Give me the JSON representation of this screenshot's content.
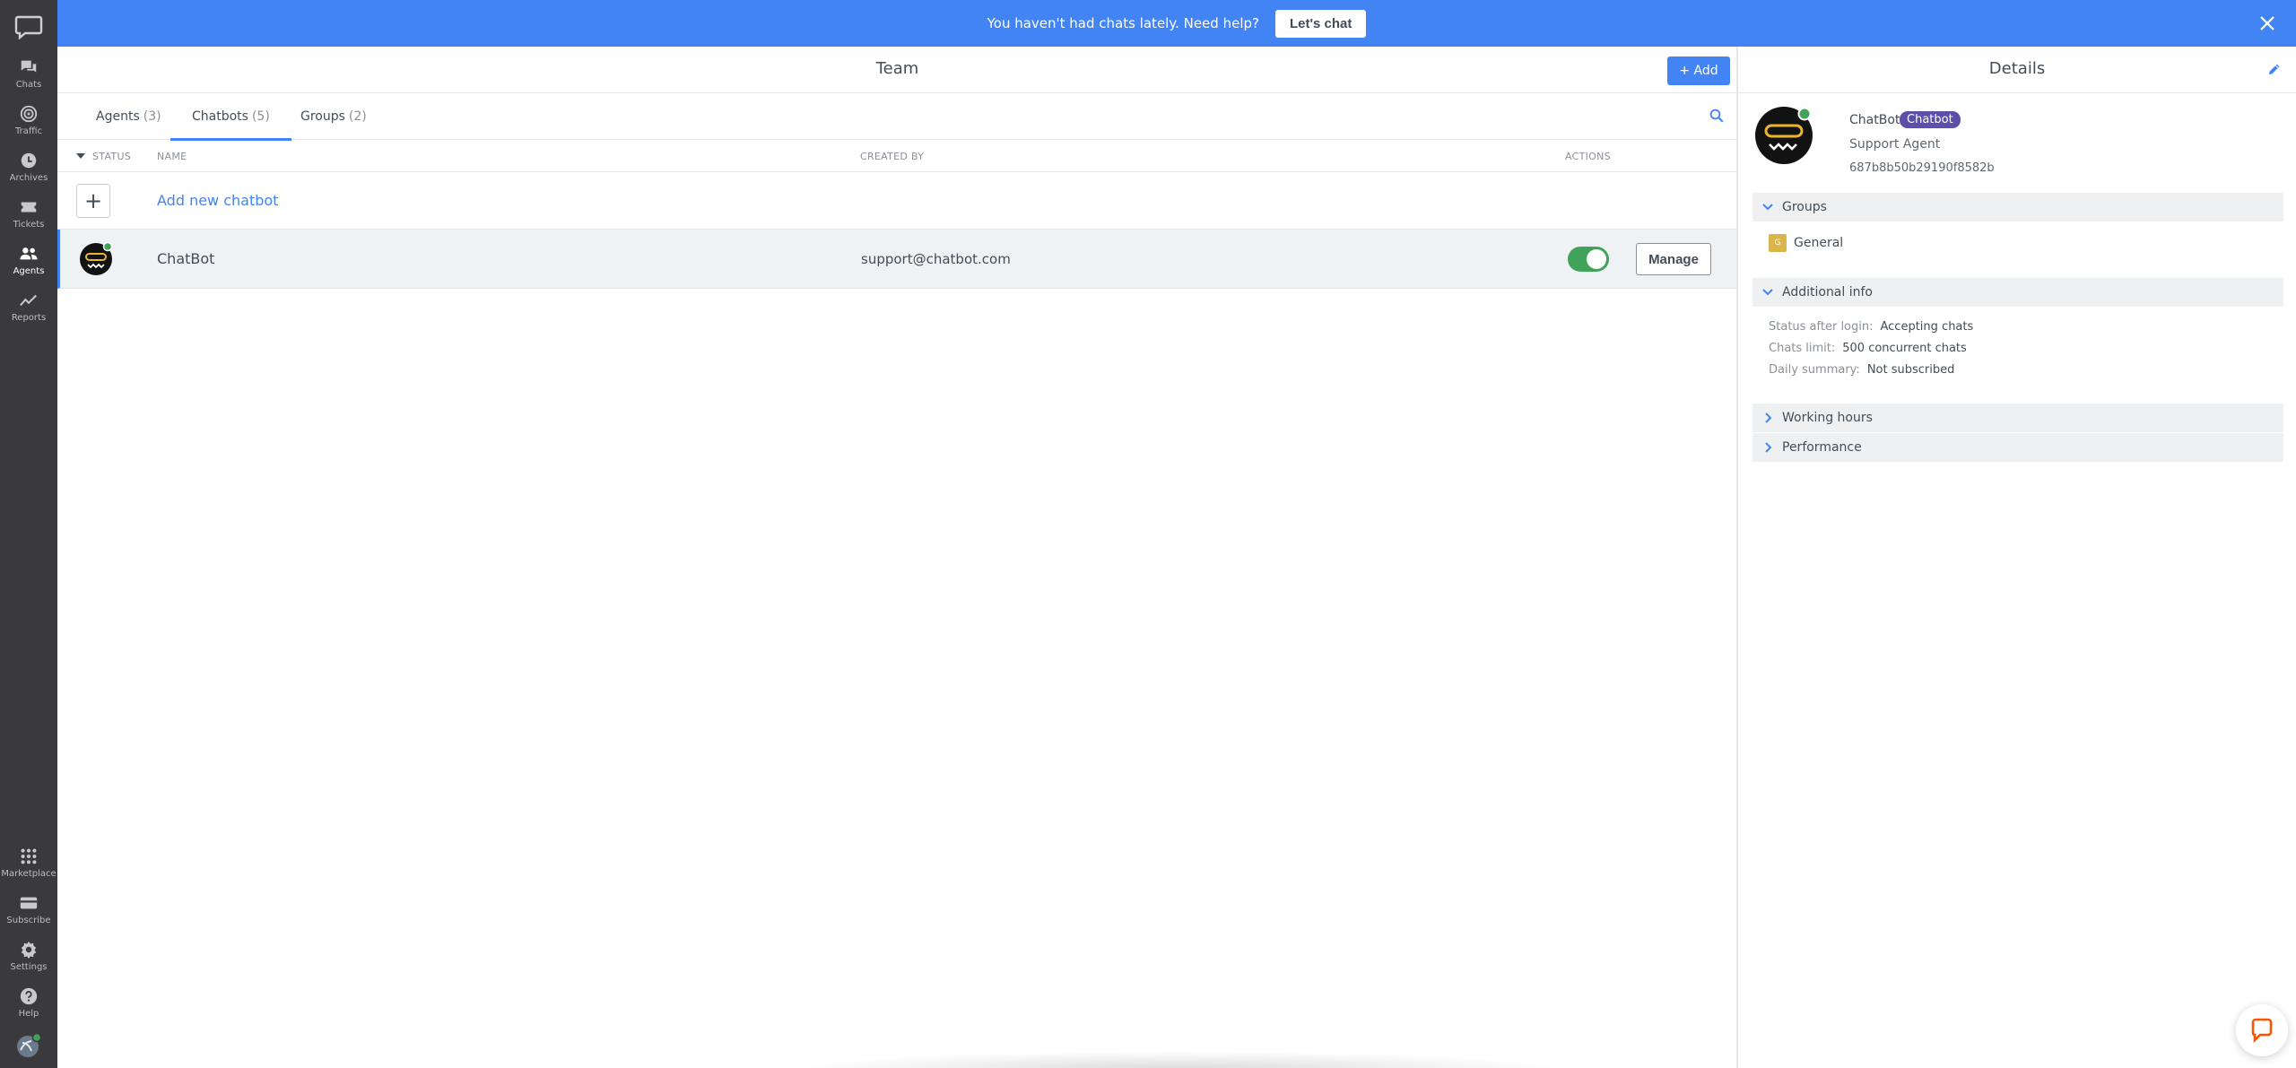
{
  "nav": {
    "items": [
      {
        "label": "Chats",
        "icon": "chat-bubbles-icon"
      },
      {
        "label": "Traffic",
        "icon": "traffic-icon"
      },
      {
        "label": "Archives",
        "icon": "clock-icon"
      },
      {
        "label": "Tickets",
        "icon": "ticket-icon"
      },
      {
        "label": "Agents",
        "icon": "people-icon",
        "active": true
      },
      {
        "label": "Reports",
        "icon": "chart-line-icon"
      }
    ],
    "bottom_items": [
      {
        "label": "Marketplace",
        "icon": "grid-icon"
      },
      {
        "label": "Subscribe",
        "icon": "credit-card-icon"
      },
      {
        "label": "Settings",
        "icon": "gear-icon"
      },
      {
        "label": "Help",
        "icon": "question-icon"
      }
    ]
  },
  "banner": {
    "message": "You haven't had chats lately. Need help?",
    "button": "Let's chat",
    "bg_color": "#4384f5"
  },
  "main": {
    "title": "Team",
    "add_button": "+ Add",
    "tabs": [
      {
        "label": "Agents",
        "count": "(3)"
      },
      {
        "label": "Chatbots",
        "count": "(5)",
        "active": true
      },
      {
        "label": "Groups",
        "count": "(2)"
      }
    ],
    "columns": {
      "status": "Status",
      "name": "Name",
      "created_by": "Created by",
      "actions": "Actions"
    },
    "add_row": {
      "label": "Add new chatbot",
      "plus": "+"
    },
    "rows": [
      {
        "name": "ChatBot",
        "created_by": "support@chatbot.com",
        "enabled": true,
        "action": "Manage"
      }
    ]
  },
  "details": {
    "title": "Details",
    "name": "ChatBot",
    "badge": "Chatbot",
    "role": "Support Agent",
    "id": "687b8b50b29190f8582b",
    "sections": {
      "groups": "Groups",
      "additional": "Additional info",
      "working_hours": "Working hours",
      "performance": "Performance"
    },
    "group": {
      "name": "General",
      "initial": "G"
    },
    "info": [
      {
        "key": "Status after login:",
        "value": "Accepting chats"
      },
      {
        "key": "Chats limit:",
        "value": "500 concurrent chats"
      },
      {
        "key": "Daily summary:",
        "value": "Not subscribed"
      }
    ]
  },
  "colors": {
    "accent": "#4384f5",
    "sidebar": "#3a3a3d",
    "toggle_on": "#41a35a",
    "badge": "#5b4fa8",
    "online": "#41a35a"
  }
}
